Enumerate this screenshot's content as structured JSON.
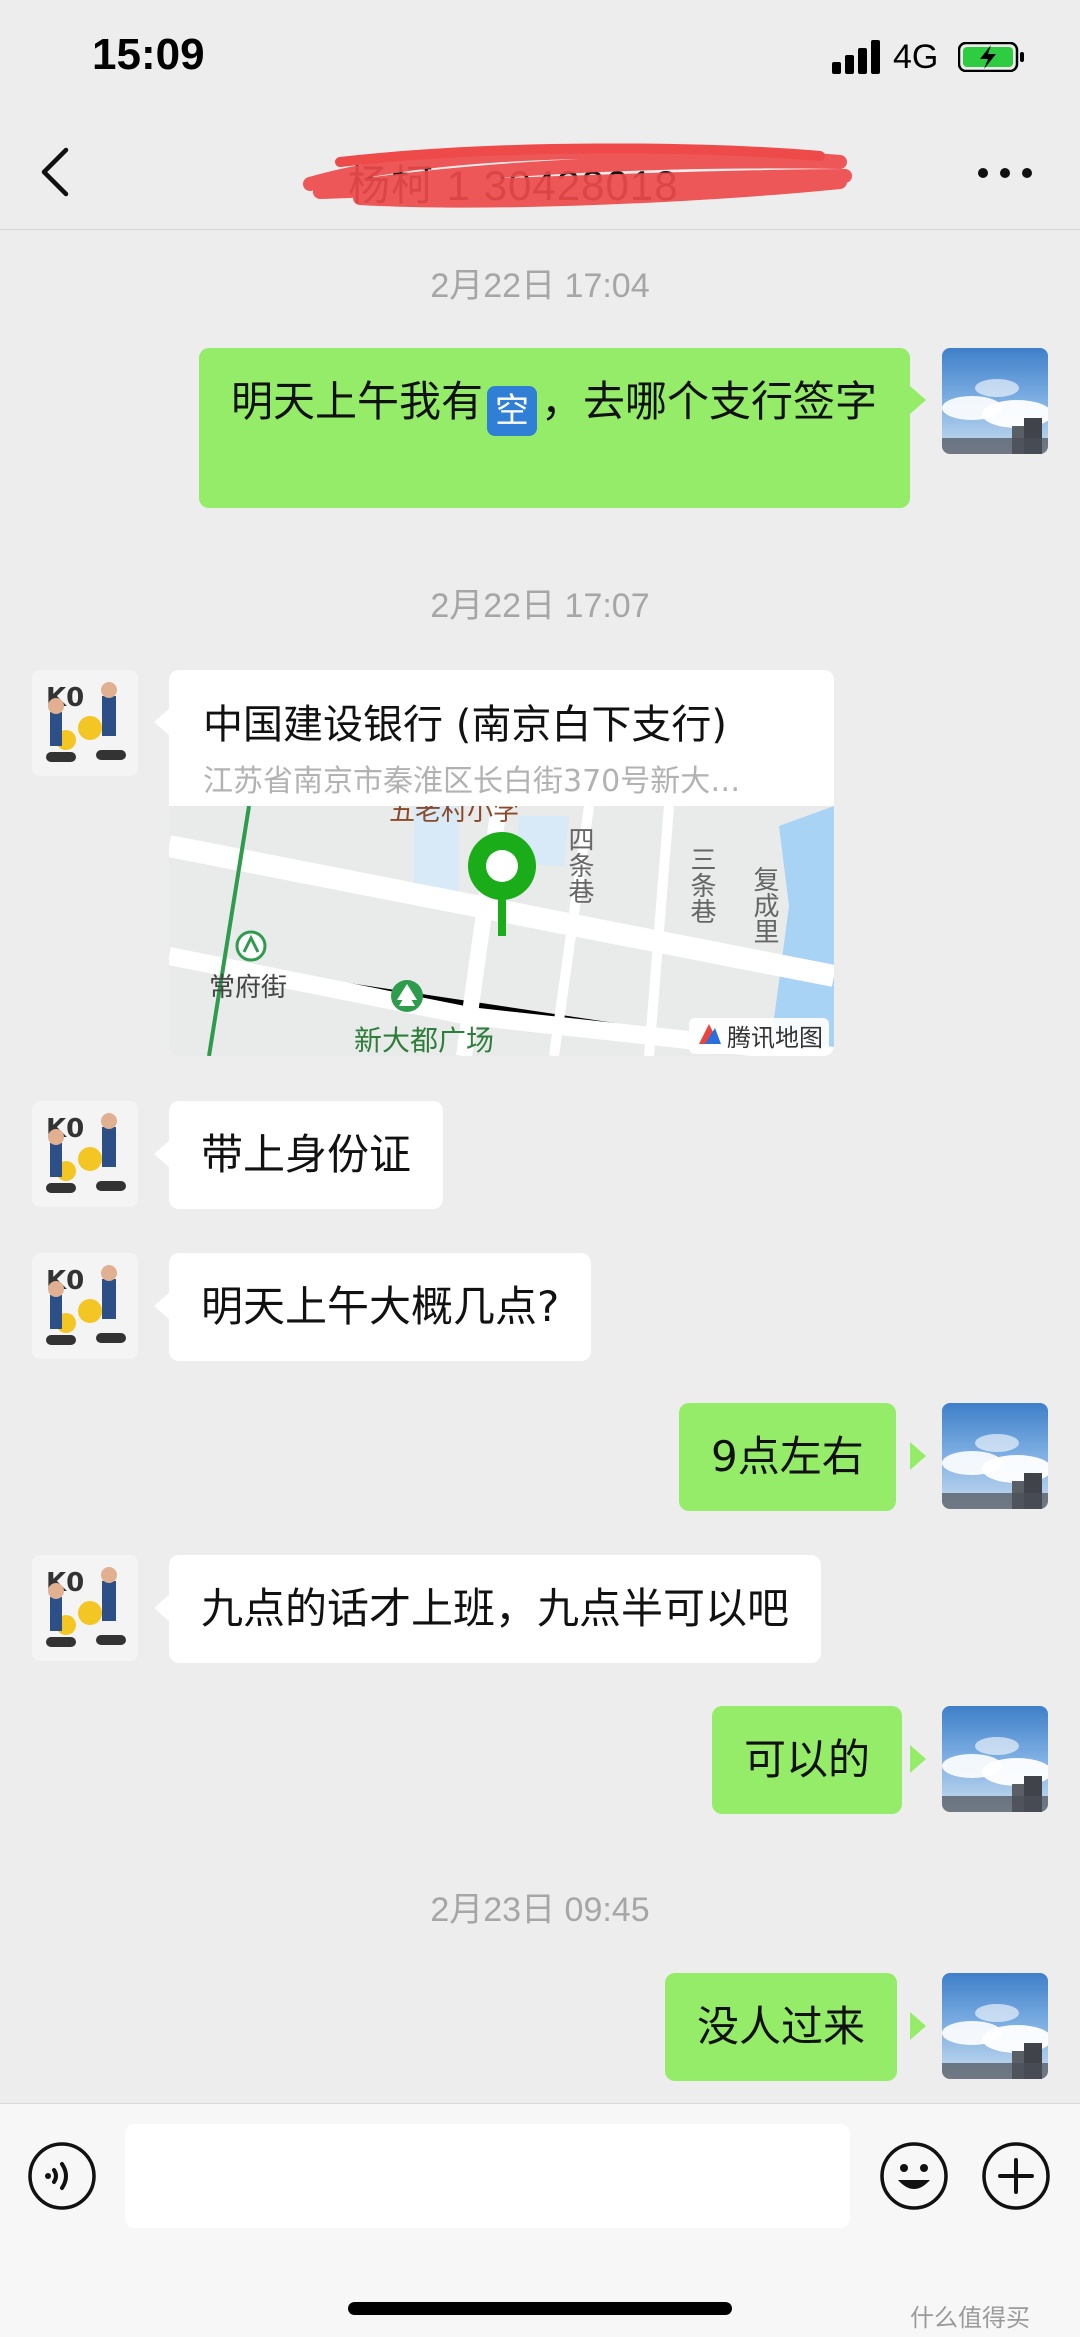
{
  "status_bar": {
    "time": "15:09",
    "network": "4G"
  },
  "nav": {
    "title": "杨柯  1  30428018"
  },
  "messages": {
    "ts1": "2月22日 17:04",
    "m1_before": "明天上午我有",
    "m1_emoji": "空",
    "m1_after": "，去哪个支行签字",
    "ts2": "2月22日 17:07",
    "location": {
      "title": "中国建设银行 (南京白下支行)",
      "address": "江苏省南京市秦淮区长白街370号新大…",
      "map_labels": {
        "school": "五老村小学",
        "lane4": "四条巷",
        "lane3": "三条巷",
        "fucheng": "复成里",
        "station": "常府街",
        "plaza": "新大都广场",
        "provider": "腾讯地图"
      }
    },
    "m2": "带上身份证",
    "m3": "明天上午大概几点?",
    "m4": "9点左右",
    "m5": "九点的话才上班，九点半可以吧",
    "m6": "可以的",
    "ts3": "2月23日 09:45",
    "m7": "没人过来"
  },
  "watermark": "什么值得买",
  "colors": {
    "my_bubble": "#95ec69",
    "their_bubble": "#ffffff",
    "background": "#ededed"
  }
}
